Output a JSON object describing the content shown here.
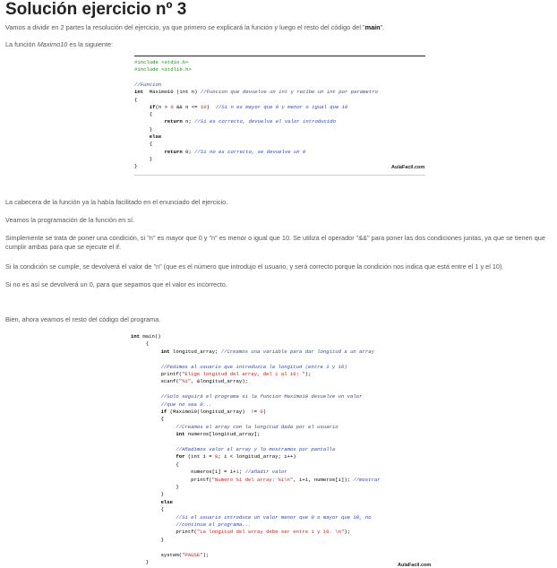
{
  "title": "Solución ejercicio nº 3",
  "intro": {
    "before": "Vamos a dividir en 2 partes la resolución del ejercicio, ya que primero se explicará la función y luego el resto del código del \"",
    "bold": "main",
    "after": "\"."
  },
  "func_intro": {
    "before": "La función ",
    "italic": "Maximo10",
    "after": " es la siguiente:"
  },
  "paragraphs": [
    "La cabecera de la función ya la había facilitado en el enunciado del ejercicio.",
    "Veamos la programación de la función en sí.",
    "Simplemente se trata de poner una condición, si \"n\" es mayor que 0 y \"n\" es menor o igual que 10. Se utiliza el operador \"&&\" para poner las dos condiciones juntas, ya que se tienen que cumplir ambas para que se ejecute el if.",
    "Si la condición se cumple, se devolverá el valor de \"n\" (que es el número que introdujo el usuario, y será correcto porque la condición nos indica que está entre el 1 y el 10).",
    "Si no es así se devolverá un 0, para que sepamos que el valor es incorrecto.",
    "Bien, ahora veamos el resto del código del programa."
  ],
  "brand": "AulaFacil.com",
  "code1": [
    [
      [
        "pp",
        "#include <stdio.h>"
      ]
    ],
    [
      [
        "pp",
        "#include <stdlib.h>"
      ]
    ],
    [],
    [
      [
        "cm",
        "//Funcion"
      ]
    ],
    [
      [
        "kw",
        "int"
      ],
      [
        "",
        "  Maximo10 (int n) "
      ],
      [
        "cm",
        "//Funcion que devuelve un int y recibe un int por parametro"
      ]
    ],
    [
      [
        "",
        "{"
      ]
    ],
    [
      [
        "",
        "     "
      ],
      [
        "kw",
        "if"
      ],
      [
        "",
        "(n > "
      ],
      [
        "nm",
        "0"
      ],
      [
        "",
        ""
      ],
      [
        "",
        ""
      ],
      [
        "",
        ""
      ],
      [
        "",
        " && n <= "
      ],
      [
        "nm",
        "10"
      ],
      [
        "",
        ")  "
      ],
      [
        "cm",
        "//Si n es mayor que 0 y menor o igual que 10"
      ]
    ],
    [
      [
        "",
        "     {"
      ]
    ],
    [
      [
        "",
        "          "
      ],
      [
        "kw",
        "return"
      ],
      [
        "",
        " n; "
      ],
      [
        "cm",
        "//Si es correcto, devuelve el valor introducido"
      ]
    ],
    [
      [
        "",
        "     }"
      ]
    ],
    [
      [
        "",
        "     "
      ],
      [
        "kw",
        "else"
      ]
    ],
    [
      [
        "",
        "     {"
      ]
    ],
    [
      [
        "",
        "          "
      ],
      [
        "kw",
        "return"
      ],
      [
        "",
        " 0; "
      ],
      [
        "cm",
        "//Si no es correcto, se devuelve un 0"
      ]
    ],
    [
      [
        "",
        "     }"
      ]
    ],
    [
      [
        "",
        "}"
      ]
    ]
  ],
  "code2": [
    [
      [
        "kw",
        "int"
      ],
      [
        "",
        " main()"
      ]
    ],
    [
      [
        "",
        "     {"
      ]
    ],
    [
      [
        "",
        "          "
      ],
      [
        "kw",
        "int"
      ],
      [
        "",
        " longitud_array; "
      ],
      [
        "cm",
        "//Creamos una variable para dar longitud a un array"
      ]
    ],
    [],
    [
      [
        "",
        "          "
      ],
      [
        "cm",
        "//Pedimos al usuario que introduzca la longitud (entre 1 y 10)"
      ]
    ],
    [
      [
        "",
        "          printf("
      ],
      [
        "st",
        "\"Elige longitud del array, del 1 al 10: \""
      ],
      [
        "",
        ");"
      ]
    ],
    [
      [
        "",
        "          scanf("
      ],
      [
        "st",
        "\"%i\""
      ],
      [
        "",
        ", &longitud_array);"
      ]
    ],
    [],
    [
      [
        "",
        "          "
      ],
      [
        "cm",
        "//Solo seguirá el programa si la funcion Maximo10 devuelve un valor"
      ]
    ],
    [
      [
        "",
        "          "
      ],
      [
        "cm",
        "//que no sea 0..."
      ]
    ],
    [
      [
        "",
        "          "
      ],
      [
        "kw",
        "if"
      ],
      [
        "",
        " (Maximo10(longitud_array)  != "
      ],
      [
        "nm",
        "0"
      ],
      [
        "",
        ")"
      ]
    ],
    [
      [
        "",
        "          {"
      ]
    ],
    [
      [
        "",
        "               "
      ],
      [
        "cm",
        "//Creamos el array con la longitud dada por el usuario"
      ]
    ],
    [
      [
        "",
        "               "
      ],
      [
        "kw",
        "int"
      ],
      [
        "",
        " numeros[longitud_array];"
      ]
    ],
    [],
    [
      [
        "",
        "               "
      ],
      [
        "cm",
        "//Añadimos valor al array y lo mostramos por pantalla"
      ]
    ],
    [
      [
        "",
        "               "
      ],
      [
        "kw",
        "for"
      ],
      [
        "",
        " (int i = "
      ],
      [
        "nm",
        "0"
      ],
      [
        "",
        "; i < longitud_array; i++)"
      ]
    ],
    [
      [
        "",
        "               {"
      ]
    ],
    [
      [
        "",
        "                    numeros[i] = i+"
      ],
      [
        "nm",
        "1"
      ],
      [
        "",
        "; "
      ],
      [
        "cm",
        "//añadir valor"
      ]
    ],
    [
      [
        "",
        "                    printf("
      ],
      [
        "st",
        "\"Numero %i del array: %i\\n\""
      ],
      [
        "",
        ", i+1, numeros[i]); "
      ],
      [
        "cm",
        "//mostrar"
      ]
    ],
    [
      [
        "",
        "               }"
      ]
    ],
    [
      [
        "",
        "          }"
      ]
    ],
    [
      [
        "",
        "          "
      ],
      [
        "kw",
        "else"
      ]
    ],
    [
      [
        "",
        "          {"
      ]
    ],
    [
      [
        "",
        "               "
      ],
      [
        "cm",
        "//Si el usuario introduce un valor menor que 0 o mayor que 10, no"
      ]
    ],
    [
      [
        "",
        "               "
      ],
      [
        "cm",
        "//continua el programa..."
      ]
    ],
    [
      [
        "",
        "               printf("
      ],
      [
        "st",
        "\"La longitud del array debe ser entre 1 y 10. \\n\""
      ],
      [
        "",
        ");"
      ]
    ],
    [
      [
        "",
        "          }"
      ]
    ],
    [],
    [
      [
        "",
        "          system("
      ],
      [
        "st",
        "\"PAUSE\""
      ],
      [
        "",
        ");"
      ]
    ],
    [
      [
        "",
        "     }"
      ]
    ]
  ]
}
